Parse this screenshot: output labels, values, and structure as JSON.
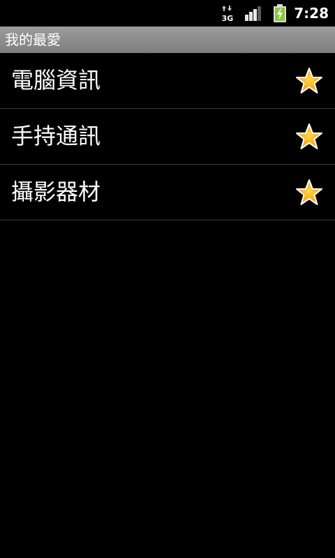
{
  "status_bar": {
    "network_icon": "3g-data-icon",
    "network_text": "3G",
    "signal_icon": "signal-strength-icon",
    "battery_icon": "battery-charging-icon",
    "time": "7:28"
  },
  "title_bar": {
    "title": "我的最愛"
  },
  "list": {
    "items": [
      {
        "label": "電腦資訊",
        "icon": "star-icon",
        "starred": true
      },
      {
        "label": "手持通訊",
        "icon": "star-icon",
        "starred": true
      },
      {
        "label": "攝影器材",
        "icon": "star-icon",
        "starred": true
      }
    ]
  },
  "colors": {
    "background": "#000000",
    "title_bar": "#8e8e8e",
    "star_fill": "#f7a800",
    "battery_fill": "#8cc63f"
  }
}
